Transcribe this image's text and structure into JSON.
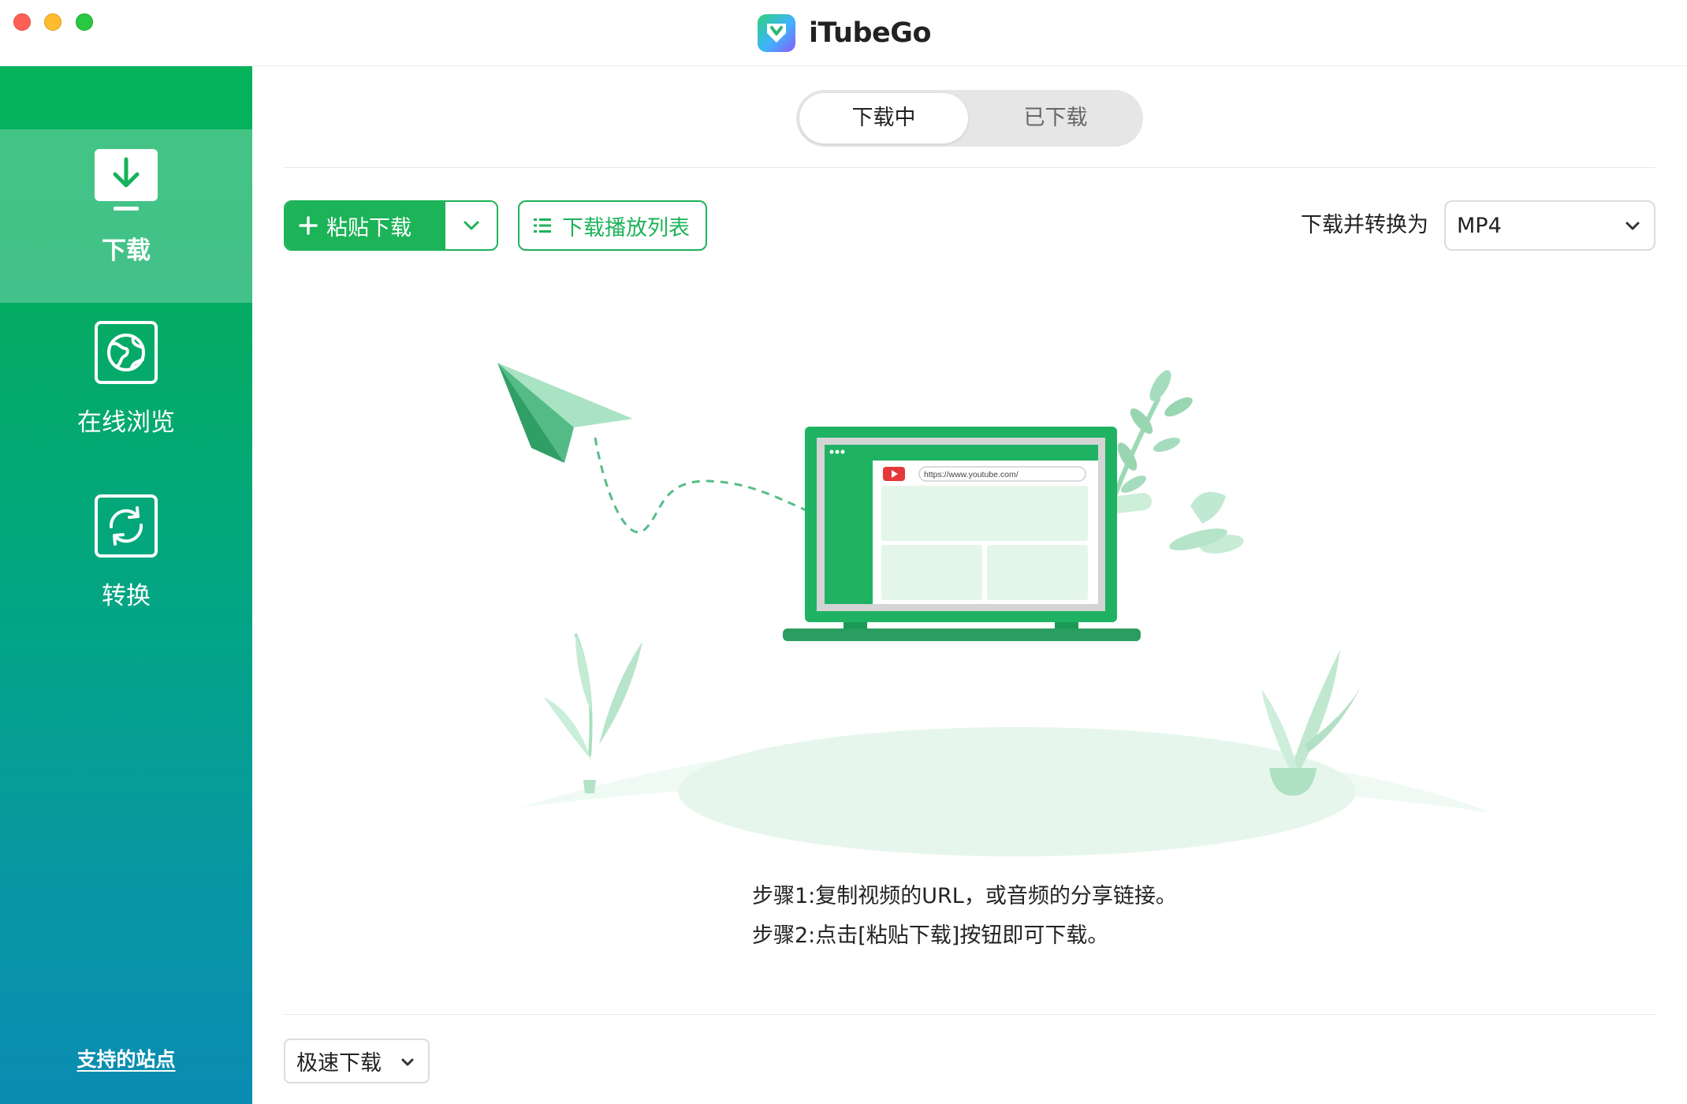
{
  "app": {
    "title": "iTubeGo"
  },
  "sidebar": {
    "items": [
      {
        "label": "下载",
        "icon": "download-icon",
        "active": true
      },
      {
        "label": "在线浏览",
        "icon": "globe-icon",
        "active": false
      },
      {
        "label": "转换",
        "icon": "convert-icon",
        "active": false
      }
    ],
    "support_link": "支持的站点"
  },
  "tabs": {
    "downloading": "下载中",
    "downloaded": "已下载",
    "active": "downloading"
  },
  "toolbar": {
    "paste_label": "粘贴下载",
    "playlist_label": "下载播放列表",
    "convert_label": "下载并转换为",
    "format_value": "MP4"
  },
  "illustration": {
    "url_text": "https://www.youtube.com/"
  },
  "steps": {
    "step1": "步骤1:复制视频的URL，或音频的分享链接。",
    "step2": "步骤2:点击[粘贴下载]按钮即可下载。"
  },
  "footer": {
    "speed_value": "极速下载"
  },
  "colors": {
    "brand_green": "#1db358",
    "sidebar_top": "#05b35b",
    "sidebar_bottom": "#0a8cb3"
  }
}
